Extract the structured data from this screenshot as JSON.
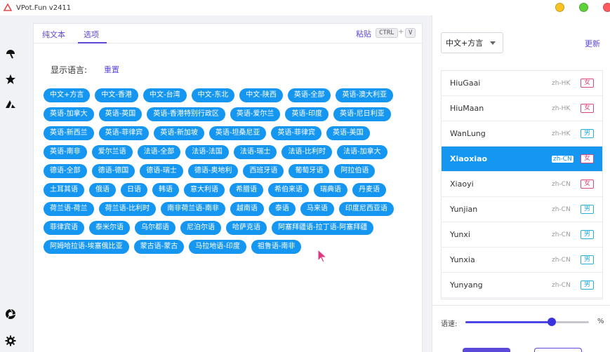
{
  "app": {
    "title": "VPot.Fun v2411"
  },
  "tabs": [
    "纯文本",
    "选项"
  ],
  "paste": {
    "label": "粘贴",
    "key1": "CTRL",
    "plus": "+",
    "key2": "V"
  },
  "options": {
    "display_language_label": "显示语言:",
    "reset_label": "重置",
    "languages": [
      "中文+方言",
      "中文-香港",
      "中文-台湾",
      "中文-东北",
      "中文-陕西",
      "英语-全部",
      "英语-澳大利亚",
      "英语-加拿大",
      "英语-英国",
      "英语-香港特别行政区",
      "英语-爱尔兰",
      "英语-印度",
      "英语-尼日利亚",
      "英语-新西兰",
      "英语-菲律宾",
      "英语-新加坡",
      "英语-坦桑尼亚",
      "英语-菲律宾",
      "英语-美国",
      "英语-南非",
      "爱尔兰语",
      "法语-全部",
      "法语-法国",
      "法语-瑞士",
      "法语-比利时",
      "法语-加拿大",
      "德语-全部",
      "德语-德国",
      "德语-瑞士",
      "德语-奥地利",
      "西班牙语",
      "葡萄牙语",
      "阿拉伯语",
      "土耳其语",
      "俄语",
      "日语",
      "韩语",
      "意大利语",
      "希腊语",
      "希伯来语",
      "瑞典语",
      "丹麦语",
      "荷兰语-荷兰",
      "荷兰语-比利时",
      "南非荷兰语-南非",
      "越南语",
      "泰语",
      "马来语",
      "印度尼西亚语",
      "菲律宾语",
      "泰米尔语",
      "乌尔都语",
      "尼泊尔语",
      "哈萨克语",
      "阿塞拜疆语-拉丁语-阿塞拜疆",
      "阿姆哈拉语-埃塞俄比亚",
      "蒙古语-蒙古",
      "马拉地语-印度",
      "祖鲁语-南非"
    ]
  },
  "right": {
    "select_value": "中文+方言",
    "update_label": "更新",
    "voices": [
      {
        "name": "HiuGaai",
        "locale": "zh-HK",
        "gender": "女",
        "selected": false
      },
      {
        "name": "HiuMaan",
        "locale": "zh-HK",
        "gender": "女",
        "selected": false
      },
      {
        "name": "WanLung",
        "locale": "zh-HK",
        "gender": "男",
        "selected": false
      },
      {
        "name": "Xiaoxiao",
        "locale": "zh-CN",
        "gender": "女",
        "selected": true
      },
      {
        "name": "Xiaoyi",
        "locale": "zh-CN",
        "gender": "女",
        "selected": false
      },
      {
        "name": "Yunjian",
        "locale": "zh-CN",
        "gender": "男",
        "selected": false
      },
      {
        "name": "Yunxi",
        "locale": "zh-CN",
        "gender": "男",
        "selected": false
      },
      {
        "name": "Yunxia",
        "locale": "zh-CN",
        "gender": "男",
        "selected": false
      },
      {
        "name": "Yunyang",
        "locale": "zh-CN",
        "gender": "男",
        "selected": false
      }
    ],
    "speed_label": "语速:",
    "speed_unit": "%",
    "speed_fraction": 0.7
  },
  "icons": {
    "app": "app-logo-icon",
    "rail": [
      "pin-icon",
      "star-icon",
      "sail-icon",
      "shutter-icon",
      "gear-icon"
    ]
  },
  "colors": {
    "accent": "#5b49d9",
    "chip": "#1496f1",
    "female": "#e0457b",
    "male": "#27b0d8"
  }
}
